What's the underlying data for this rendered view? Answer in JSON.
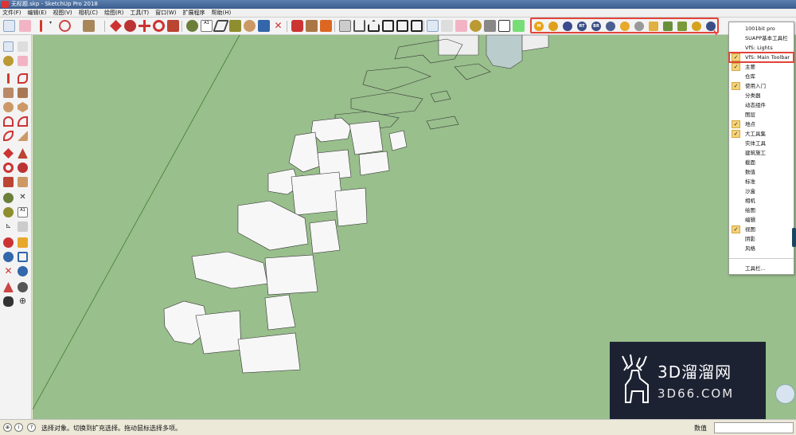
{
  "window": {
    "title": "无标题.skp - SketchUp Pro 2018"
  },
  "menu": [
    "文件(F)",
    "编辑(E)",
    "视图(V)",
    "相机(C)",
    "绘图(R)",
    "工具(T)",
    "窗口(W)",
    "扩展程序",
    "帮助(H)"
  ],
  "toolbar": {
    "icons": [
      "select-icon",
      "eraser-icon",
      "pencil-icon",
      "arc-icon",
      "shape-icon",
      "push-pull-icon",
      "follow-me-icon",
      "move-icon",
      "rotate-icon",
      "scale-icon",
      "tape-measure-icon",
      "text-icon",
      "paint-bucket-icon",
      "section-icon",
      "warehouse-icon",
      "component-icon"
    ],
    "vfs_icons": [
      "M",
      "",
      "",
      "RT",
      "BR",
      "",
      "",
      "",
      "",
      "",
      "",
      "",
      ""
    ]
  },
  "context_menu": {
    "items": [
      {
        "label": "1001bit pro",
        "checked": false,
        "highlight": false
      },
      {
        "label": "SUAPP基本工具栏",
        "checked": false,
        "highlight": false
      },
      {
        "label": "VfS: Lights",
        "checked": false,
        "highlight": false
      },
      {
        "label": "VfS: Main Toolbar",
        "checked": true,
        "highlight": true
      },
      {
        "label": "主要",
        "checked": true,
        "highlight": false
      },
      {
        "label": "仓库",
        "checked": false,
        "highlight": false
      },
      {
        "label": "使用入门",
        "checked": true,
        "highlight": false
      },
      {
        "label": "分类器",
        "checked": false,
        "highlight": false
      },
      {
        "label": "动态组件",
        "checked": false,
        "highlight": false
      },
      {
        "label": "图层",
        "checked": false,
        "highlight": false
      },
      {
        "label": "地点",
        "checked": true,
        "highlight": false
      },
      {
        "label": "大工具集",
        "checked": true,
        "highlight": false
      },
      {
        "label": "实体工具",
        "checked": false,
        "highlight": false
      },
      {
        "label": "建筑施工",
        "checked": false,
        "highlight": false
      },
      {
        "label": "截面",
        "checked": false,
        "highlight": false
      },
      {
        "label": "数值",
        "checked": false,
        "highlight": false
      },
      {
        "label": "标准",
        "checked": false,
        "highlight": false
      },
      {
        "label": "沙盒",
        "checked": false,
        "highlight": false
      },
      {
        "label": "相机",
        "checked": false,
        "highlight": false
      },
      {
        "label": "绘图",
        "checked": false,
        "highlight": false
      },
      {
        "label": "编辑",
        "checked": false,
        "highlight": false
      },
      {
        "label": "视图",
        "checked": true,
        "highlight": false
      },
      {
        "label": "阴影",
        "checked": false,
        "highlight": false
      },
      {
        "label": "风格",
        "checked": false,
        "highlight": false
      }
    ],
    "footer": "工具栏..."
  },
  "status": {
    "message": "选择对象。切换到扩充选择。拖动鼠标选择多项。",
    "vcb_label": "数值",
    "vcb_value": ""
  },
  "watermark": {
    "line1": "3D溜溜网",
    "line2": "3D66.COM"
  },
  "colors": {
    "viewport": "#99bf8c",
    "highlight": "#e2443a",
    "check": "#f5d27a"
  }
}
